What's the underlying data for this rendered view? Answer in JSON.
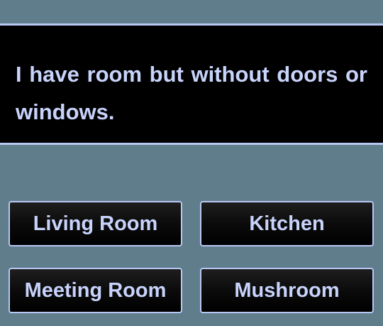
{
  "question": {
    "text": "I have room but without doors or windows."
  },
  "answers": [
    {
      "label": "Living Room"
    },
    {
      "label": "Kitchen"
    },
    {
      "label": "Meeting Room"
    },
    {
      "label": "Mushroom"
    }
  ],
  "colors": {
    "background": "#607d8b",
    "panel": "#000000",
    "border": "#b9c7f5",
    "text": "#c8d3fb"
  }
}
